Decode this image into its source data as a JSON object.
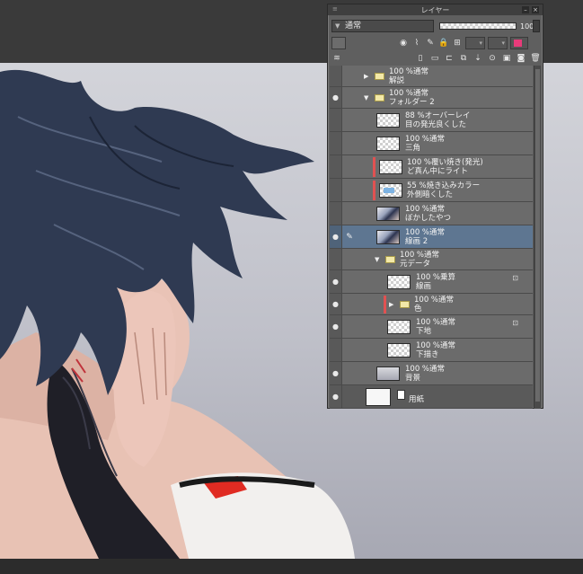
{
  "panel": {
    "title": "レイヤー",
    "titlebar_left": "≡",
    "blend_mode": "通常",
    "opacity": "100"
  },
  "layers": [
    {
      "mode": "100 %通常",
      "name": "解説",
      "type": "folder",
      "state": "collapsed"
    },
    {
      "mode": "100 %通常",
      "name": "フォルダー 2",
      "type": "folder",
      "state": "expanded"
    },
    {
      "mode": "88 %オーバーレイ",
      "name": "目の発光良くした"
    },
    {
      "mode": "100 %通常",
      "name": "三角"
    },
    {
      "mode": "100 %覆い焼き(発光)",
      "name": "ど真ん中にライト"
    },
    {
      "mode": "55 %焼き込みカラー",
      "name": "外側暗くした"
    },
    {
      "mode": "100 %通常",
      "name": "ぼかしたやつ"
    },
    {
      "mode": "100 %通常",
      "name": "線画 2",
      "selected": true
    },
    {
      "mode": "100 %通常",
      "name": "元データ",
      "type": "folder",
      "state": "expanded"
    },
    {
      "mode": "100 %乗算",
      "name": "線画"
    },
    {
      "mode": "100 %通常",
      "name": "色",
      "type": "folder",
      "state": "collapsed"
    },
    {
      "mode": "100 %通常",
      "name": "下地"
    },
    {
      "mode": "100 %通常",
      "name": "下描き"
    },
    {
      "mode": "100 %通常",
      "name": "背景"
    },
    {
      "name": "用紙",
      "type": "paper"
    }
  ],
  "colors": {
    "panel_bg": "#5f5f5f",
    "selected_row": "#5e7691",
    "marker_red": "#e05252",
    "canvas_top": "#d3d4da",
    "canvas_bottom": "#a7a8b3"
  },
  "icons": [
    "eye-icon",
    "brush-icon",
    "folder-icon",
    "lock-icon",
    "new-layer-icon",
    "trash-icon",
    "close-icon"
  ]
}
